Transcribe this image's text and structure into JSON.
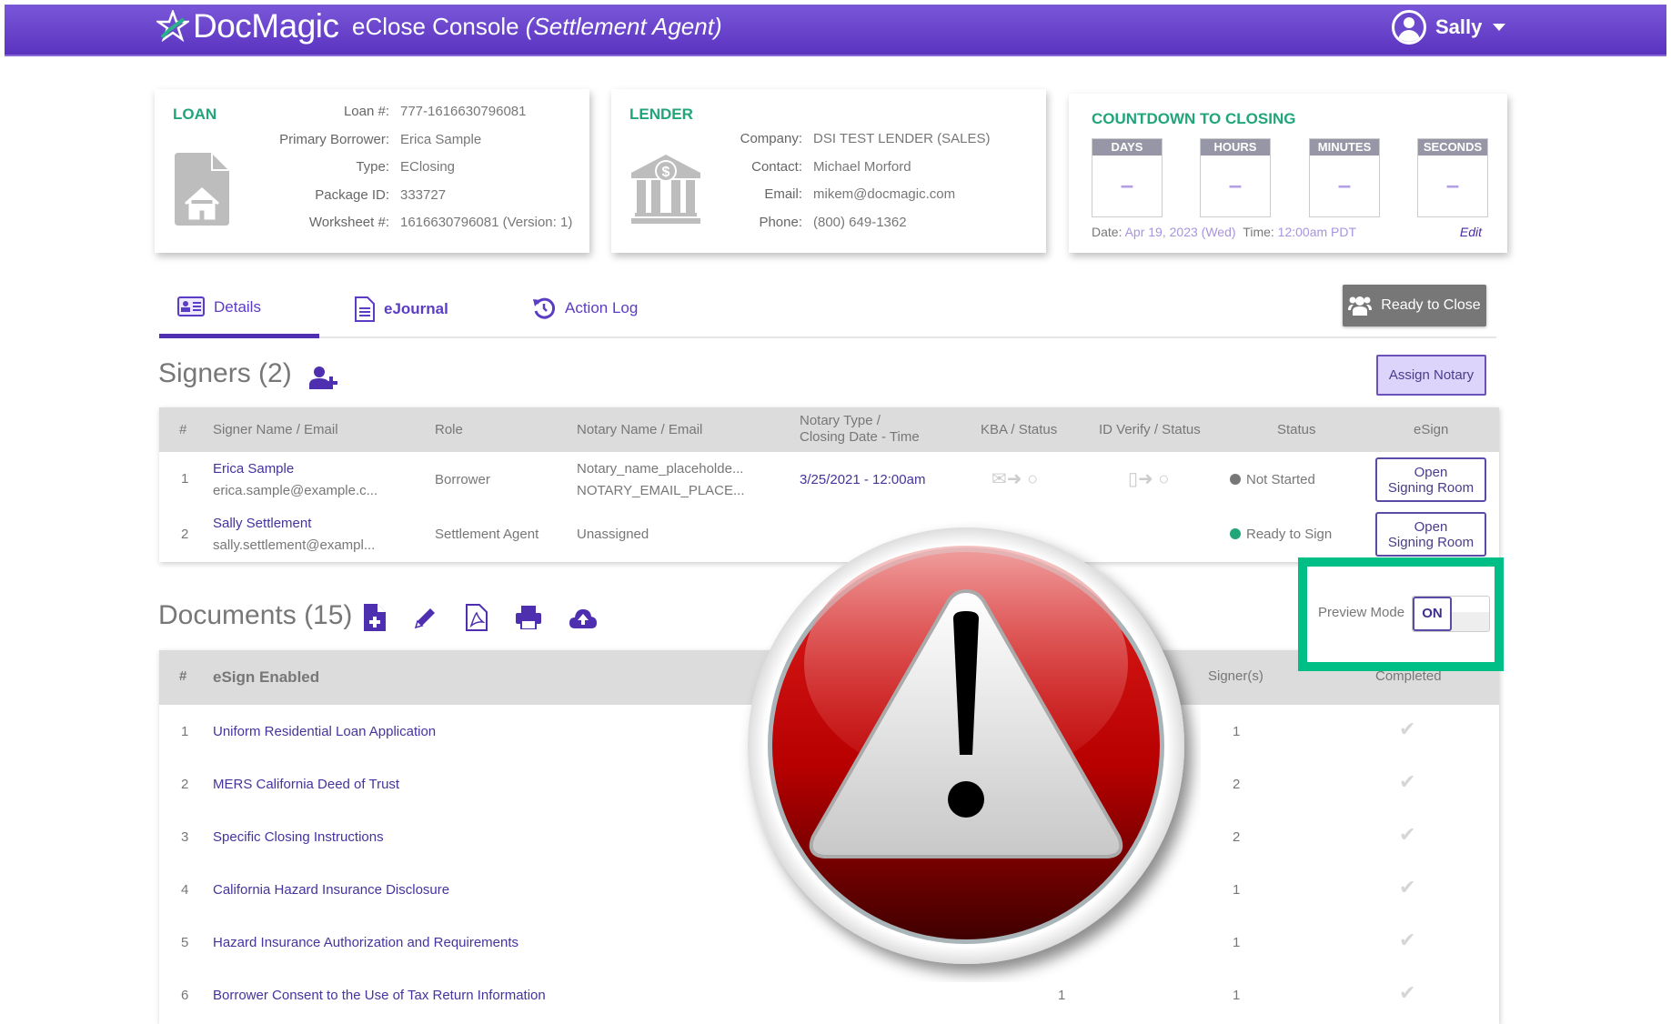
{
  "header": {
    "logo": "DocMagic",
    "title": "eClose Console",
    "role": "(Settlement Agent)",
    "user": "Sally"
  },
  "loan": {
    "title": "LOAN",
    "fields": [
      {
        "label": "Loan #:",
        "value": "777-1616630796081"
      },
      {
        "label": "Primary Borrower:",
        "value": "Erica Sample"
      },
      {
        "label": "Type:",
        "value": "EClosing"
      },
      {
        "label": "Package ID:",
        "value": "333727"
      },
      {
        "label": "Worksheet #:",
        "value": "1616630796081 (Version: 1)"
      }
    ]
  },
  "lender": {
    "title": "LENDER",
    "fields": [
      {
        "label": "Company:",
        "value": "DSI TEST LENDER (SALES)"
      },
      {
        "label": "Contact:",
        "value": "Michael Morford"
      },
      {
        "label": "Email:",
        "value": "mikem@docmagic.com"
      },
      {
        "label": "Phone:",
        "value": "(800) 649-1362"
      }
    ]
  },
  "countdown": {
    "title": "COUNTDOWN TO CLOSING",
    "units": [
      {
        "label": "DAYS",
        "value": "–"
      },
      {
        "label": "HOURS",
        "value": "–"
      },
      {
        "label": "MINUTES",
        "value": "–"
      },
      {
        "label": "SECONDS",
        "value": "–"
      }
    ],
    "date_label": "Date:",
    "date_value": "Apr 19, 2023 (Wed)",
    "time_label": "Time:",
    "time_value": "12:00am PDT",
    "edit": "Edit"
  },
  "tabs": [
    {
      "label": "Details",
      "active": true
    },
    {
      "label": "eJournal",
      "active": false
    },
    {
      "label": "Action Log",
      "active": false
    }
  ],
  "ready_to_close": "Ready to Close",
  "signers": {
    "title": "Signers (2)",
    "assign_notary": "Assign Notary",
    "headers": [
      "#",
      "Signer Name / Email",
      "Role",
      "Notary Name / Email",
      "Notary Type /",
      "Closing Date - Time",
      "KBA / Status",
      "ID Verify / Status",
      "Status",
      "eSign"
    ],
    "rows": [
      {
        "num": "1",
        "name": "Erica Sample",
        "email": "erica.sample@example.c...",
        "role": "Borrower",
        "notary_name": "Notary_name_placeholde...",
        "notary_email": "NOTARY_EMAIL_PLACE...",
        "closing": "3/25/2021 - 12:00am",
        "status": "Not Started",
        "status_color": "#777777",
        "esign_line1": "Open",
        "esign_line2": "Signing Room"
      },
      {
        "num": "2",
        "name": "Sally Settlement",
        "email": "sally.settlement@exampl...",
        "role": "Settlement Agent",
        "notary_name": "Unassigned",
        "notary_email": "",
        "closing": "",
        "status": "Ready to Sign",
        "status_color": "#21a57a",
        "esign_line1": "Open",
        "esign_line2": "Signing Room"
      }
    ]
  },
  "documents": {
    "title": "Documents (15)",
    "preview_mode_label": "Preview Mode",
    "preview_mode_value": "ON",
    "headers": [
      "#",
      "eSign Enabled",
      "Signer(s)",
      "Completed"
    ],
    "rows": [
      {
        "num": "1",
        "name": "Uniform Residential Loan Application",
        "extra": "",
        "signers": "1"
      },
      {
        "num": "2",
        "name": "MERS California Deed of Trust",
        "extra": "",
        "signers": "2"
      },
      {
        "num": "3",
        "name": "Specific Closing Instructions",
        "extra": "",
        "signers": "2"
      },
      {
        "num": "4",
        "name": "California Hazard Insurance Disclosure",
        "extra": "",
        "signers": "1"
      },
      {
        "num": "5",
        "name": "Hazard Insurance Authorization and Requirements",
        "extra": "",
        "signers": "1"
      },
      {
        "num": "6",
        "name": "Borrower Consent to the Use of Tax Return Information",
        "extra": "1",
        "signers": "1"
      }
    ]
  },
  "colors": {
    "brand": "#5a33bf",
    "accent_green": "#21a57a",
    "highlight_box": "#00bf86",
    "link": "#45339e"
  }
}
